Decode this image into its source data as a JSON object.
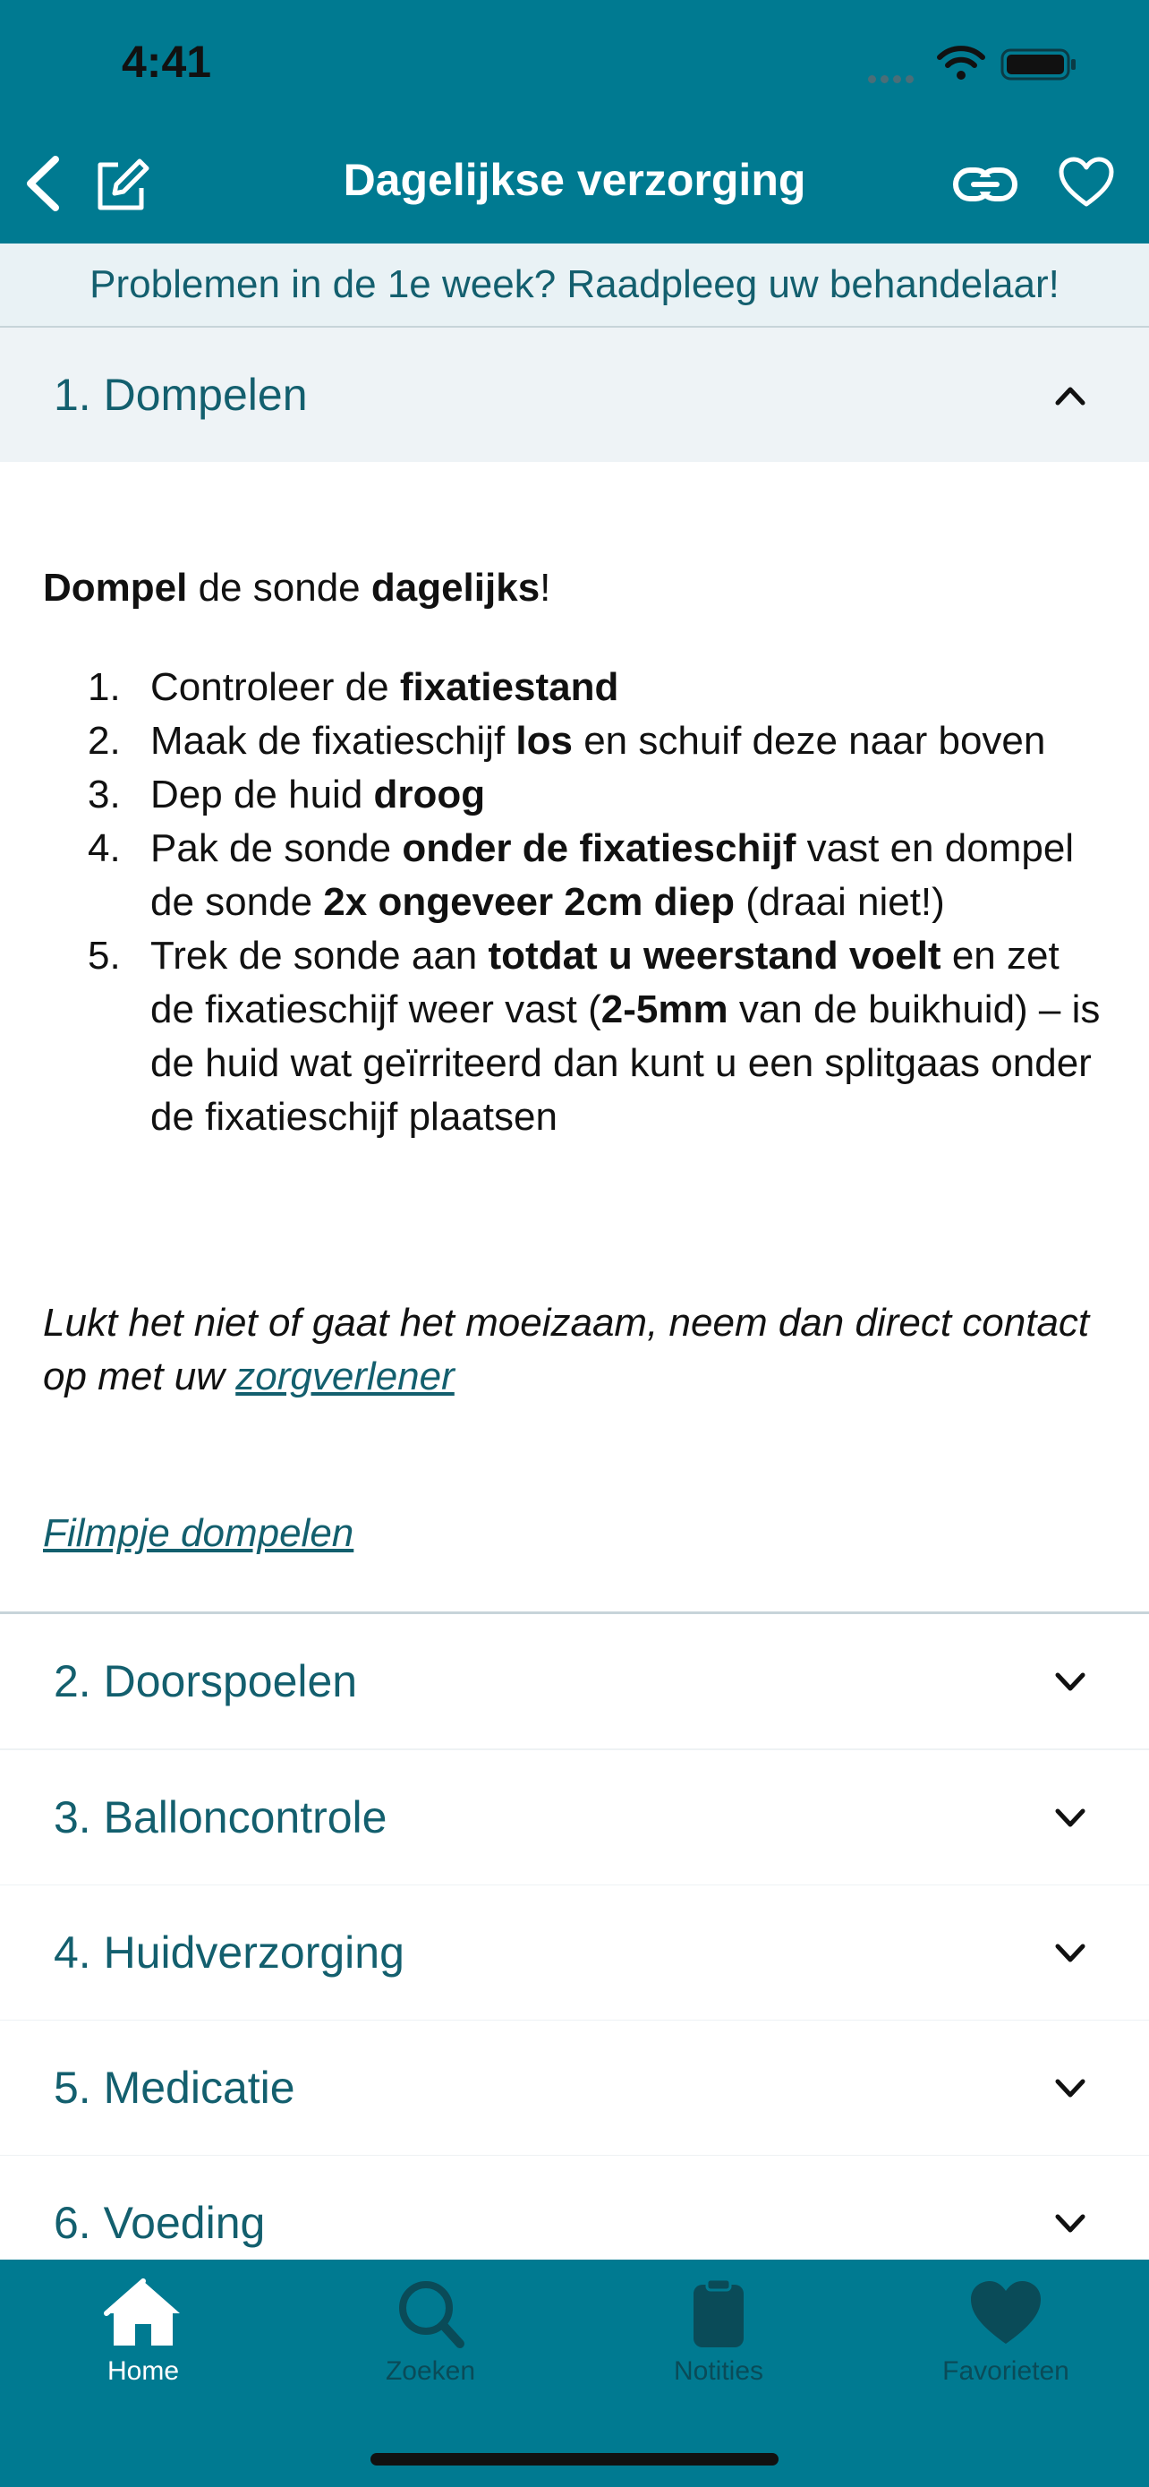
{
  "status": {
    "time": "4:41"
  },
  "nav": {
    "title": "Dagelijkse verzorging"
  },
  "banner": {
    "text": "Problemen in de 1e week? Raadpleeg uw behandelaar!"
  },
  "accordion_open": {
    "title": "1. Dompelen",
    "intro": [
      {
        "b": "Dompel"
      },
      {
        "t": " de sonde "
      },
      {
        "b": "dagelijks"
      },
      {
        "t": "!"
      }
    ],
    "steps": [
      {
        "num": "1.",
        "parts": [
          {
            "t": "Controleer de "
          },
          {
            "b": "fixatiestand"
          }
        ]
      },
      {
        "num": "2.",
        "parts": [
          {
            "t": "Maak de fixatieschijf "
          },
          {
            "b": "los"
          },
          {
            "t": " en schuif deze naar boven"
          }
        ]
      },
      {
        "num": "3.",
        "parts": [
          {
            "t": "Dep de huid "
          },
          {
            "b": "droog"
          }
        ]
      },
      {
        "num": "4.",
        "parts": [
          {
            "t": "Pak de sonde "
          },
          {
            "b": "onder de fixatieschijf"
          },
          {
            "t": " vast en dompel de sonde "
          },
          {
            "b": "2x ongeveer 2cm diep"
          },
          {
            "t": " (draai niet!)"
          }
        ]
      },
      {
        "num": "5.",
        "parts": [
          {
            "t": "Trek de sonde aan "
          },
          {
            "b": "totdat u weerstand voelt"
          },
          {
            "t": " en zet de fixatieschijf weer vast ("
          },
          {
            "b": "2-5mm"
          },
          {
            "t": " van de buikhuid) – is de huid wat geïrriteerd dan kunt u een splitgaas onder de fixatieschijf plaatsen"
          }
        ]
      }
    ],
    "note_prefix": "Lukt het niet of gaat het moeizaam, neem dan direct contact op met uw ",
    "note_link": "zorgverlener",
    "video_link": "Filmpje dompelen"
  },
  "accordion_items": [
    {
      "title": "2. Doorspoelen"
    },
    {
      "title": "3. Balloncontrole"
    },
    {
      "title": "4. Huidverzorging"
    },
    {
      "title": "5. Medicatie"
    },
    {
      "title": "6. Voeding"
    }
  ],
  "tabs": [
    {
      "label": "Home",
      "icon": "home-icon",
      "active": true
    },
    {
      "label": "Zoeken",
      "icon": "search-icon",
      "active": false
    },
    {
      "label": "Notities",
      "icon": "clipboard-icon",
      "active": false
    },
    {
      "label": "Favorieten",
      "icon": "heart-icon",
      "active": false
    }
  ],
  "colors": {
    "primary": "#007a91",
    "accent_text": "#135f6e",
    "banner_bg": "#e9f2f5",
    "tab_inactive": "#0a4b58"
  }
}
